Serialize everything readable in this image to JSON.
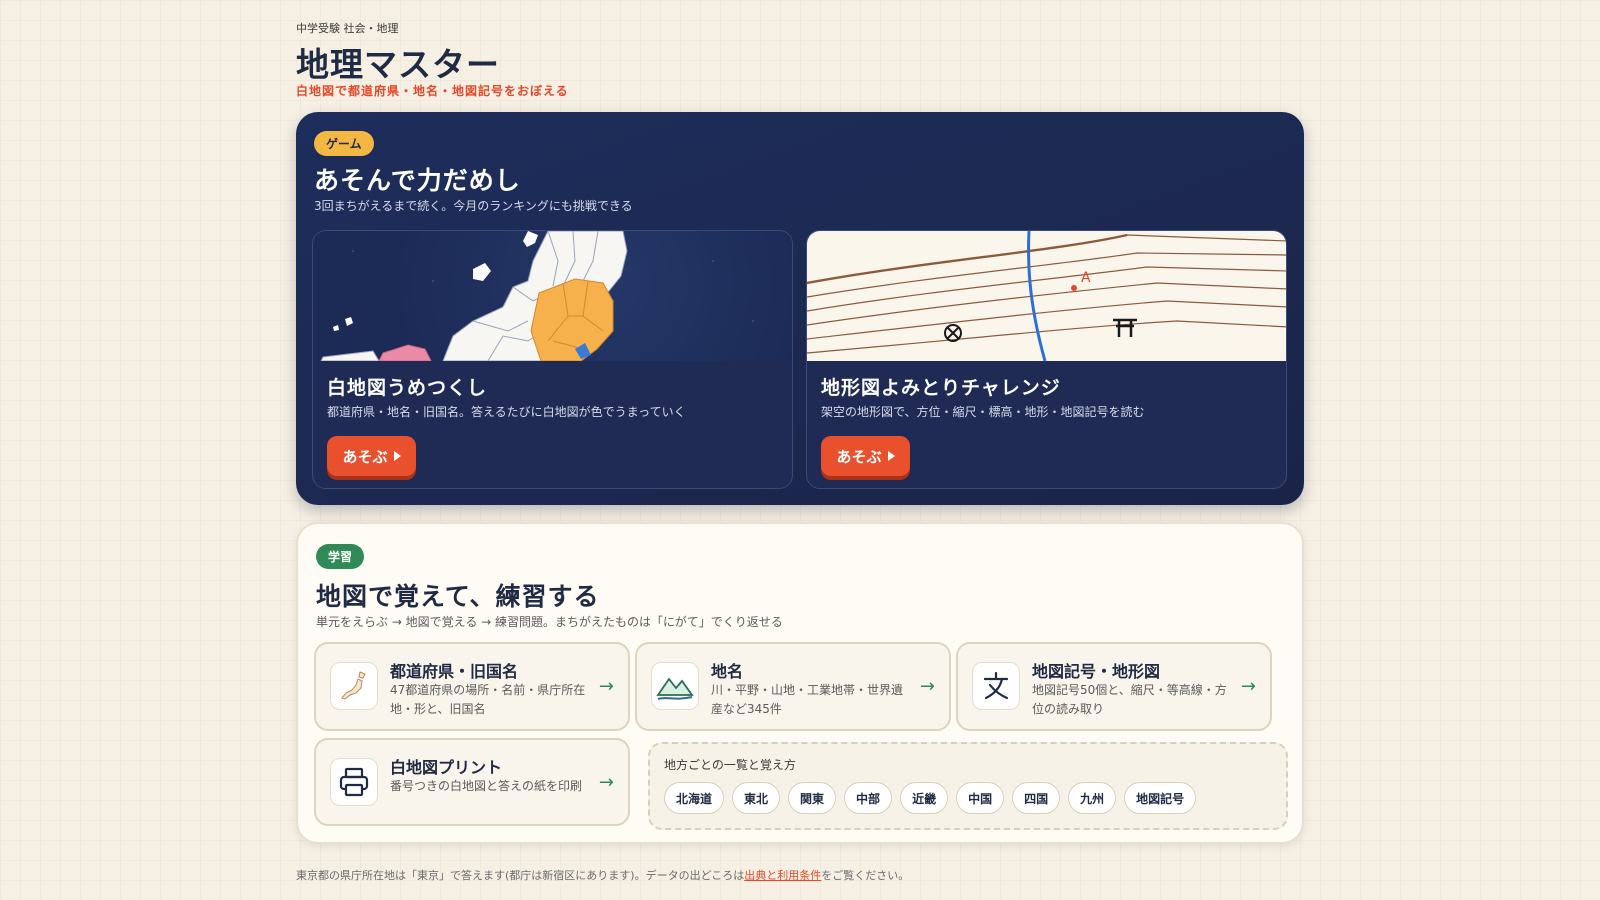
{
  "header": {
    "kicker": "中学受験 社会・地理",
    "title": "地理マスター",
    "tagline": "白地図で都道府県・地名・地図記号をおぼえる"
  },
  "game_section": {
    "badge": "ゲーム",
    "heading": "あそんで力だめし",
    "subtitle": "3回まちがえるまで続く。今月のランキングにも挑戦できる",
    "cards": [
      {
        "title": "白地図うめつくし",
        "description": "都道府県・地名・旧国名。答えるたびに白地図が色でうまっていく",
        "button_label": "あそぶ",
        "art_icon": "japan-map-icon"
      },
      {
        "title": "地形図よみとりチャレンジ",
        "description": "架空の地形図で、方位・縮尺・標高・地形・地図記号を読む",
        "button_label": "あそぶ",
        "art_icon": "contour-map-icon",
        "point_label": "A"
      }
    ]
  },
  "study_section": {
    "badge": "学習",
    "heading": "地図で覚えて、練習する",
    "subtitle": "単元をえらぶ → 地図で覚える → 練習問題。まちがえたものは「にがて」でくり返せる",
    "cards": [
      {
        "title": "都道府県・旧国名",
        "description": "47都道府県の場所・名前・県庁所在地・形と、旧国名",
        "icon": "japan-outline-icon",
        "arrow": "→"
      },
      {
        "title": "地名",
        "description": "川・平野・山地・工業地帯・世界遺産など345件",
        "icon": "mountain-icon",
        "arrow": "→"
      },
      {
        "title": "地図記号・地形図",
        "description": "地図記号50個と、縮尺・等高線・方位の読み取り",
        "icon": "map-symbol-icon",
        "arrow": "→"
      },
      {
        "title": "白地図プリント",
        "description": "番号つきの白地図と答えの紙を印刷",
        "icon": "printer-icon",
        "arrow": "→"
      }
    ],
    "regions": {
      "title": "地方ごとの一覧と覚え方",
      "chips": [
        "北海道",
        "東北",
        "関東",
        "中部",
        "近畿",
        "中国",
        "四国",
        "九州",
        "地図記号"
      ]
    }
  },
  "footer": {
    "note_before": "東京都の県庁所在地は「東京」で答えます(都庁は新宿区にあります)。データの出どころは",
    "link_label": "出典と利用条件",
    "note_after": "をご覧ください。"
  },
  "colors": {
    "accent_red": "#e8502e",
    "game_bg": "#1e2d5c",
    "study_green": "#2f8a55",
    "badge_yellow": "#f4b744",
    "page_bg": "#f6efe4"
  }
}
